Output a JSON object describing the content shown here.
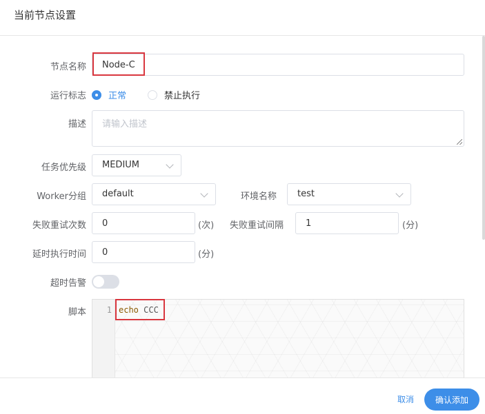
{
  "header": {
    "title": "当前节点设置"
  },
  "form": {
    "node_name": {
      "label": "节点名称",
      "value": "Node-C"
    },
    "run_flag": {
      "label": "运行标志",
      "options": [
        "正常",
        "禁止执行"
      ],
      "selected": "正常"
    },
    "description": {
      "label": "描述",
      "placeholder": "请输入描述"
    },
    "priority": {
      "label": "任务优先级",
      "value": "MEDIUM"
    },
    "worker_group": {
      "label": "Worker分组",
      "value": "default"
    },
    "environment": {
      "label": "环境名称",
      "value": "test"
    },
    "retry_times": {
      "label": "失败重试次数",
      "value": "0",
      "suffix": "(次)"
    },
    "retry_interval": {
      "label": "失败重试间隔",
      "value": "1",
      "suffix": "(分)"
    },
    "delay_time": {
      "label": "延时执行时间",
      "value": "0",
      "suffix": "(分)"
    },
    "timeout_alarm": {
      "label": "超时告警",
      "enabled": false
    },
    "script": {
      "label": "脚本",
      "line_number": "1",
      "keyword": "echo",
      "argument": "CCC"
    }
  },
  "footer": {
    "cancel_label": "取消",
    "confirm_label": "确认添加"
  },
  "colors": {
    "accent": "#3d8ee8",
    "highlight": "#d9363e"
  }
}
